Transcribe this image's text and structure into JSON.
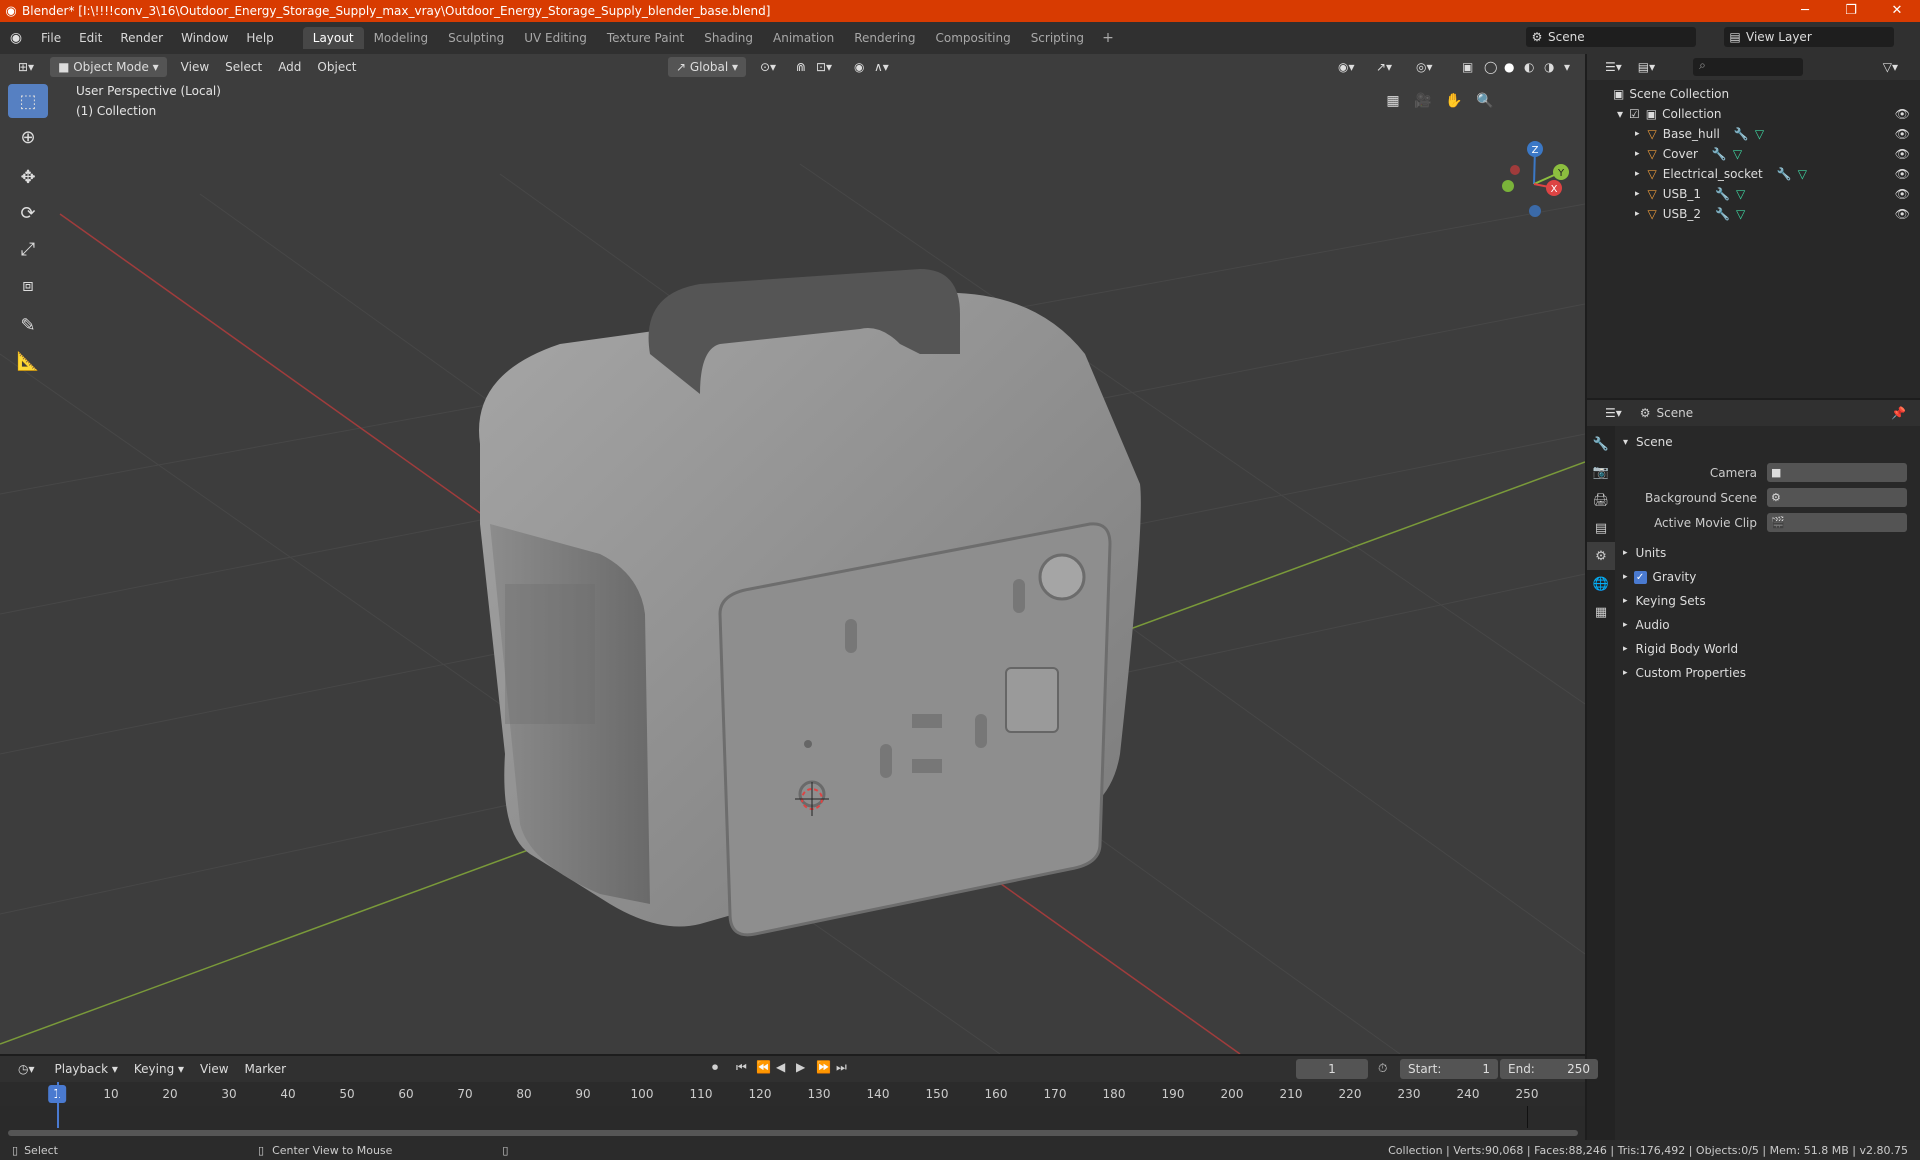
{
  "app": {
    "title": "Blender* [I:\\!!!!conv_3\\16\\Outdoor_Energy_Storage_Supply_max_vray\\Outdoor_Energy_Storage_Supply_blender_base.blend]",
    "accent_color": "#d83b01"
  },
  "window_controls": {
    "minimize": "─",
    "maximize": "❐",
    "close": "✕"
  },
  "menu": [
    "File",
    "Edit",
    "Render",
    "Window",
    "Help"
  ],
  "workspaces": {
    "tabs": [
      "Layout",
      "Modeling",
      "Sculpting",
      "UV Editing",
      "Texture Paint",
      "Shading",
      "Animation",
      "Rendering",
      "Compositing",
      "Scripting"
    ],
    "active": "Layout",
    "add": "+"
  },
  "scene_selector": {
    "value": "Scene"
  },
  "view_layer_selector": {
    "value": "View Layer"
  },
  "viewport": {
    "mode": "Object Mode",
    "menus": [
      "View",
      "Select",
      "Add",
      "Object"
    ],
    "transform_orientation": "Global",
    "info_line1": "User Perspective (Local)",
    "info_line2": "(1) Collection",
    "gizmo_labels": {
      "x": "X",
      "y": "Y",
      "z": "Z"
    },
    "background_color": "#3d3d3d"
  },
  "outliner": {
    "root": "Scene Collection",
    "collection": "Collection",
    "objects": [
      "Base_hull",
      "Cover",
      "Electrical_socket",
      "USB_1",
      "USB_2"
    ]
  },
  "properties": {
    "context": "Scene",
    "section": "Scene",
    "fields": [
      {
        "label": "Camera",
        "value": ""
      },
      {
        "label": "Background Scene",
        "value": ""
      },
      {
        "label": "Active Movie Clip",
        "value": ""
      }
    ],
    "panels": [
      "Units",
      "Gravity",
      "Keying Sets",
      "Audio",
      "Rigid Body World",
      "Custom Properties"
    ],
    "gravity_checked": true
  },
  "timeline": {
    "menus": [
      "Playback",
      "Keying",
      "View",
      "Marker"
    ],
    "current_frame": "1",
    "start_label": "Start:",
    "start": "1",
    "end_label": "End:",
    "end": "250",
    "ticks": [
      "1",
      "10",
      "20",
      "30",
      "40",
      "50",
      "60",
      "70",
      "80",
      "90",
      "100",
      "110",
      "120",
      "130",
      "140",
      "150",
      "160",
      "170",
      "180",
      "190",
      "200",
      "210",
      "220",
      "230",
      "240",
      "250"
    ]
  },
  "statusbar": {
    "left": "Select",
    "middle": "Center View to Mouse",
    "right": "Collection | Verts:90,068 | Faces:88,246 | Tris:176,492 | Objects:0/5 | Mem: 51.8 MB | v2.80.75"
  }
}
